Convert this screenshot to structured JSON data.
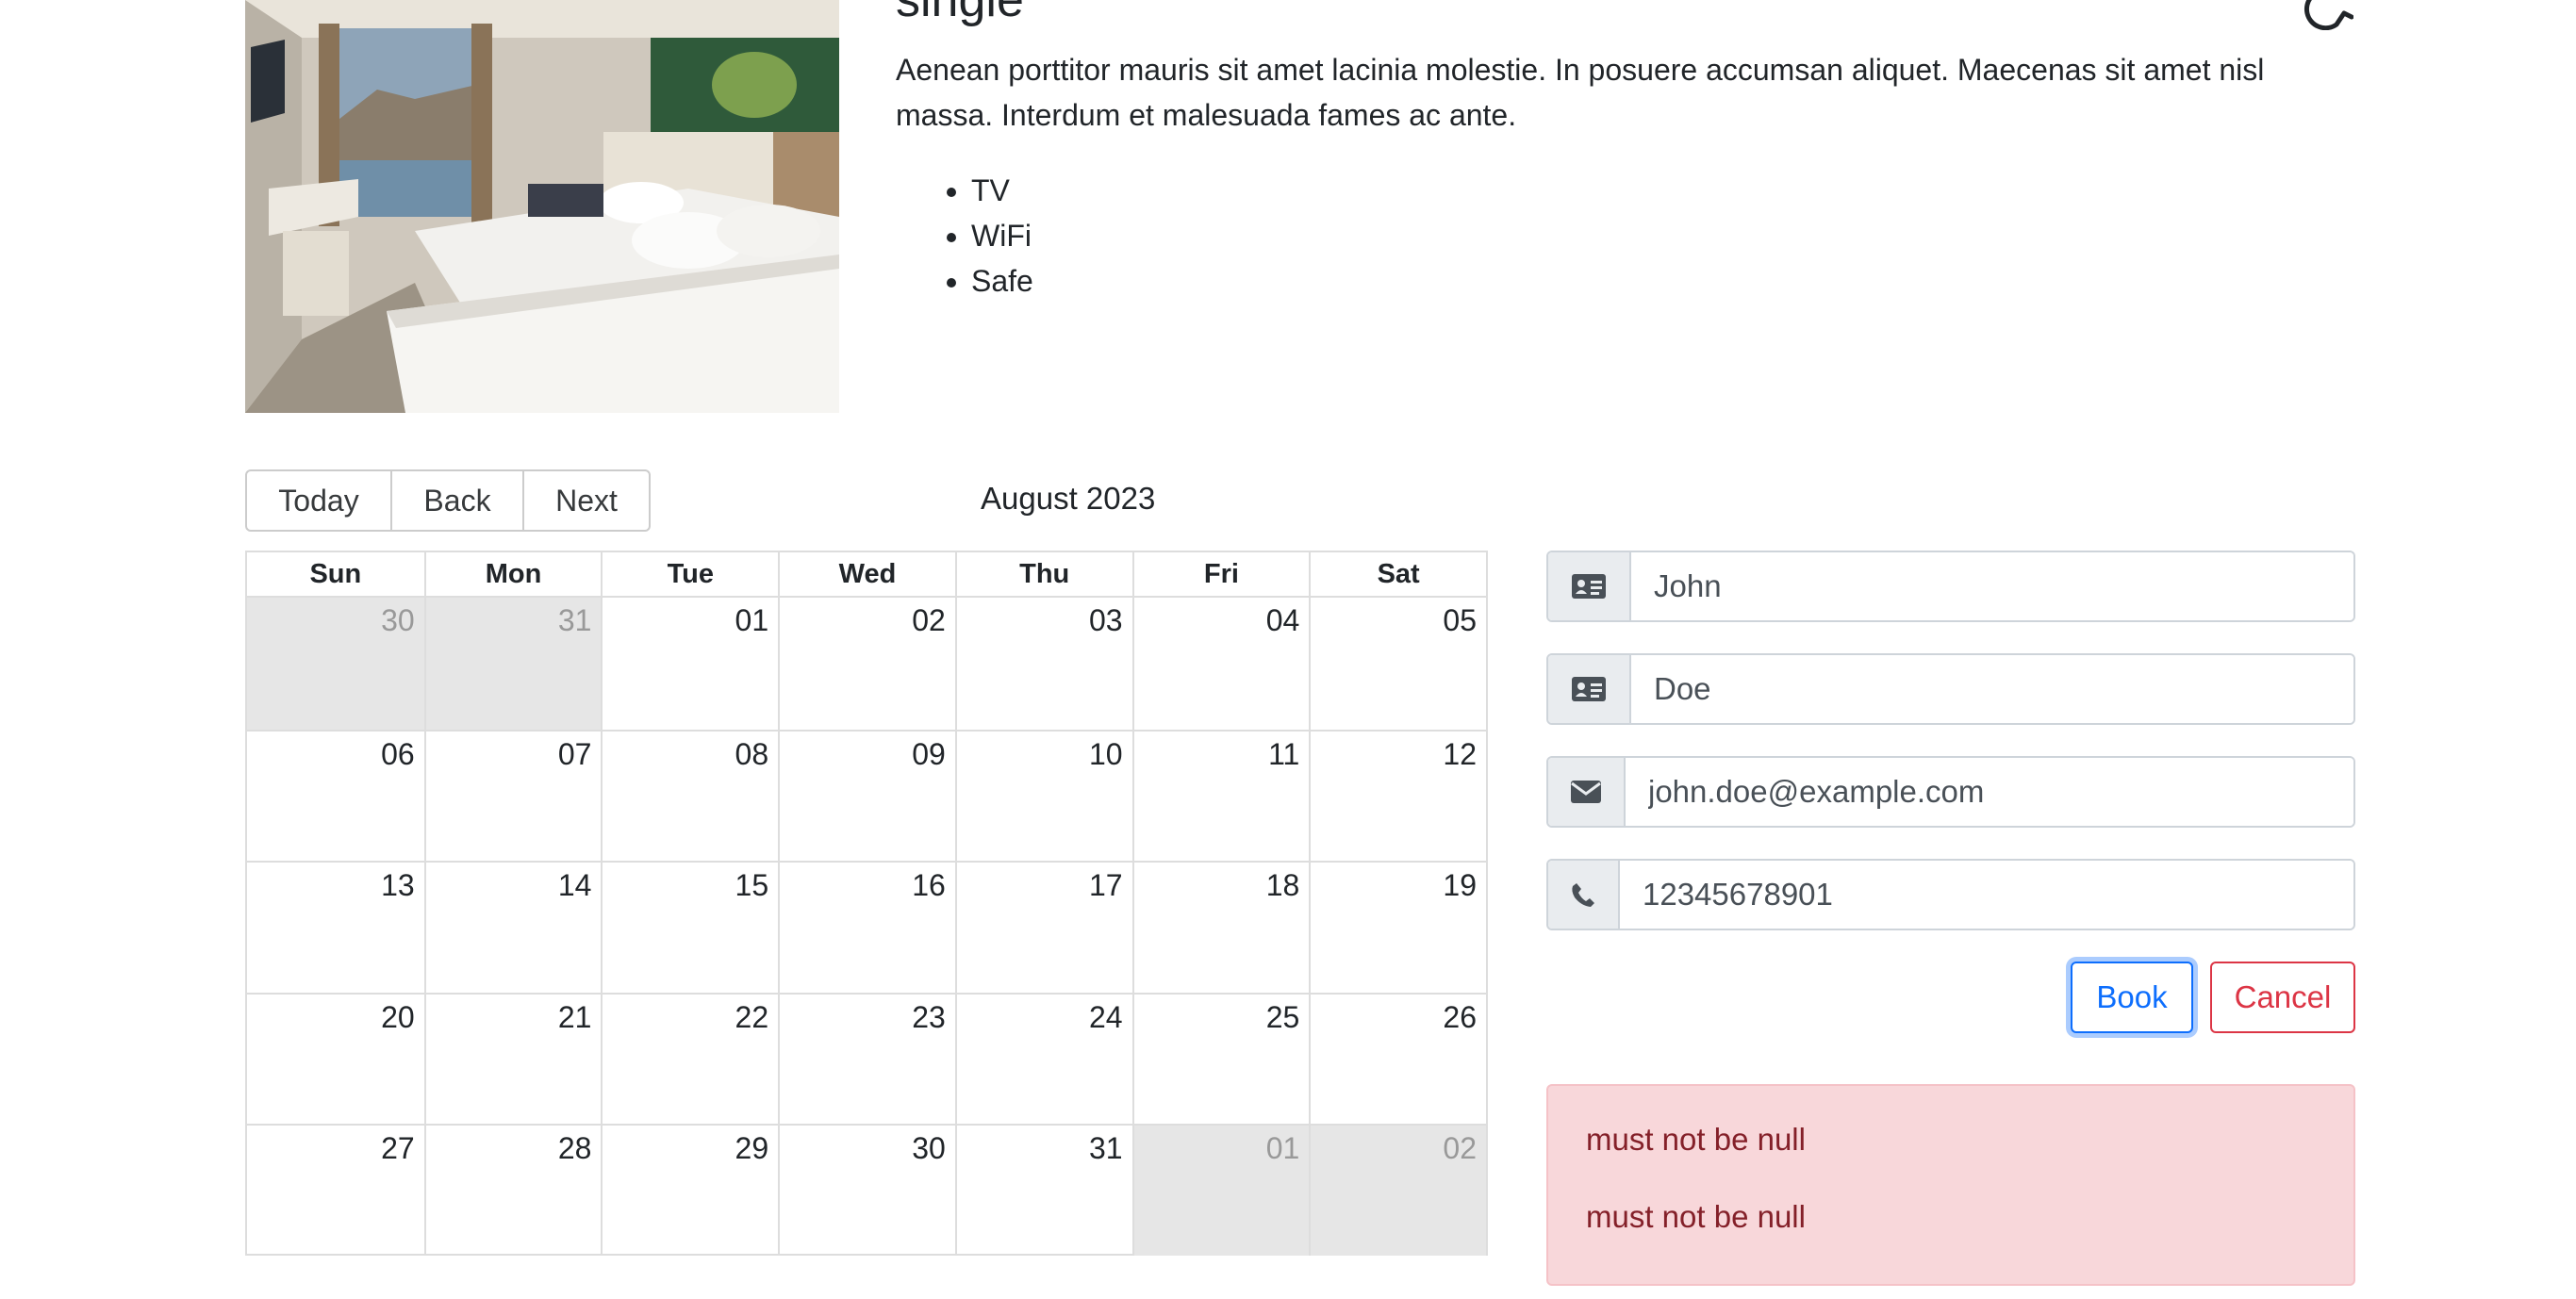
{
  "room": {
    "title": "single",
    "description": "Aenean porttitor mauris sit amet lacinia molestie. In posuere accumsan aliquet. Maecenas sit amet nisl massa. Interdum et malesuada fames ac ante.",
    "features": [
      "TV",
      "WiFi",
      "Safe"
    ],
    "accessible_icon": "wheelchair-icon"
  },
  "calendar": {
    "toolbar": {
      "today": "Today",
      "back": "Back",
      "next": "Next"
    },
    "month_label": "August 2023",
    "weekdays": [
      "Sun",
      "Mon",
      "Tue",
      "Wed",
      "Thu",
      "Fri",
      "Sat"
    ],
    "weeks": [
      [
        "30",
        "31",
        "01",
        "02",
        "03",
        "04",
        "05"
      ],
      [
        "06",
        "07",
        "08",
        "09",
        "10",
        "11",
        "12"
      ],
      [
        "13",
        "14",
        "15",
        "16",
        "17",
        "18",
        "19"
      ],
      [
        "20",
        "21",
        "22",
        "23",
        "24",
        "25",
        "26"
      ],
      [
        "27",
        "28",
        "29",
        "30",
        "31",
        "01",
        "02"
      ]
    ],
    "off_range": [
      [
        0,
        0
      ],
      [
        0,
        1
      ],
      [
        4,
        5
      ],
      [
        4,
        6
      ]
    ],
    "off_range_color": "#e6e6e6"
  },
  "form": {
    "firstname": {
      "value": "John",
      "icon": "id-card-icon"
    },
    "lastname": {
      "value": "Doe",
      "icon": "id-card-icon"
    },
    "email": {
      "value": "john.doe@example.com",
      "icon": "envelope-icon"
    },
    "phone": {
      "value": "12345678901",
      "icon": "phone-icon"
    },
    "book_label": "Book",
    "cancel_label": "Cancel"
  },
  "errors": [
    "must not be null",
    "must not be null"
  ],
  "colors": {
    "primary": "#0d6efd",
    "danger": "#dc3545",
    "alert_bg": "#f8d7da",
    "alert_text": "#842029"
  }
}
